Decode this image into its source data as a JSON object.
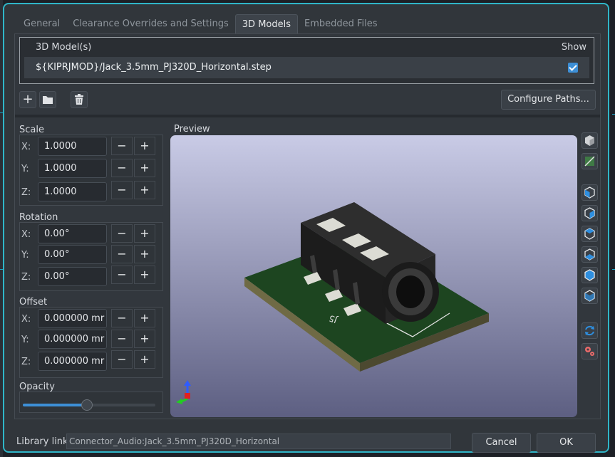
{
  "tabs": [
    "General",
    "Clearance Overrides and Settings",
    "3D Models",
    "Embedded Files"
  ],
  "active_tab": "3D Models",
  "model_table": {
    "col_name": "3D Model(s)",
    "col_show": "Show",
    "rows": [
      {
        "path": "${KIPRJMOD}/Jack_3.5mm_PJ320D_Horizontal.step",
        "show": true
      }
    ]
  },
  "toolbar": {
    "add_icon": "plus-icon",
    "browse_icon": "folder-icon",
    "delete_icon": "trash-icon",
    "configure_label": "Configure Paths..."
  },
  "scale": {
    "title": "Scale",
    "x_label": "X:",
    "y_label": "Y:",
    "z_label": "Z:",
    "x": "1.0000",
    "y": "1.0000",
    "z": "1.0000"
  },
  "rotation": {
    "title": "Rotation",
    "x_label": "X:",
    "y_label": "Y:",
    "z_label": "Z:",
    "x": "0.00°",
    "y": "0.00°",
    "z": "0.00°"
  },
  "offset": {
    "title": "Offset",
    "x_label": "X:",
    "y_label": "Y:",
    "z_label": "Z:",
    "x": "0.000000 mr",
    "y": "0.000000 mr",
    "z": "0.000000 mr"
  },
  "stepper": {
    "minus": "−",
    "plus": "+"
  },
  "opacity": {
    "title": "Opacity",
    "level": 0.46
  },
  "preview": {
    "title": "Preview",
    "silkscreen_ref": "J5",
    "colors": {
      "board": "#1d4520",
      "board_edge": "#6f6a45",
      "body": "#2a2a2a",
      "pad": "#dcdcd4",
      "bg_top": "#c9cbe6",
      "bg_bottom": "#5d5f82"
    }
  },
  "side_buttons": [
    "material-icon",
    "board-toggle-icon",
    "view-front-icon",
    "view-back-icon",
    "view-left-icon",
    "view-right-icon",
    "view-top-icon",
    "view-bottom-icon",
    "reload-icon",
    "settings-icon"
  ],
  "library_link": {
    "label": "Library link:",
    "value": "Connector_Audio:Jack_3.5mm_PJ320D_Horizontal"
  },
  "buttons": {
    "cancel": "Cancel",
    "ok": "OK"
  },
  "accent": "#2fb6c8"
}
